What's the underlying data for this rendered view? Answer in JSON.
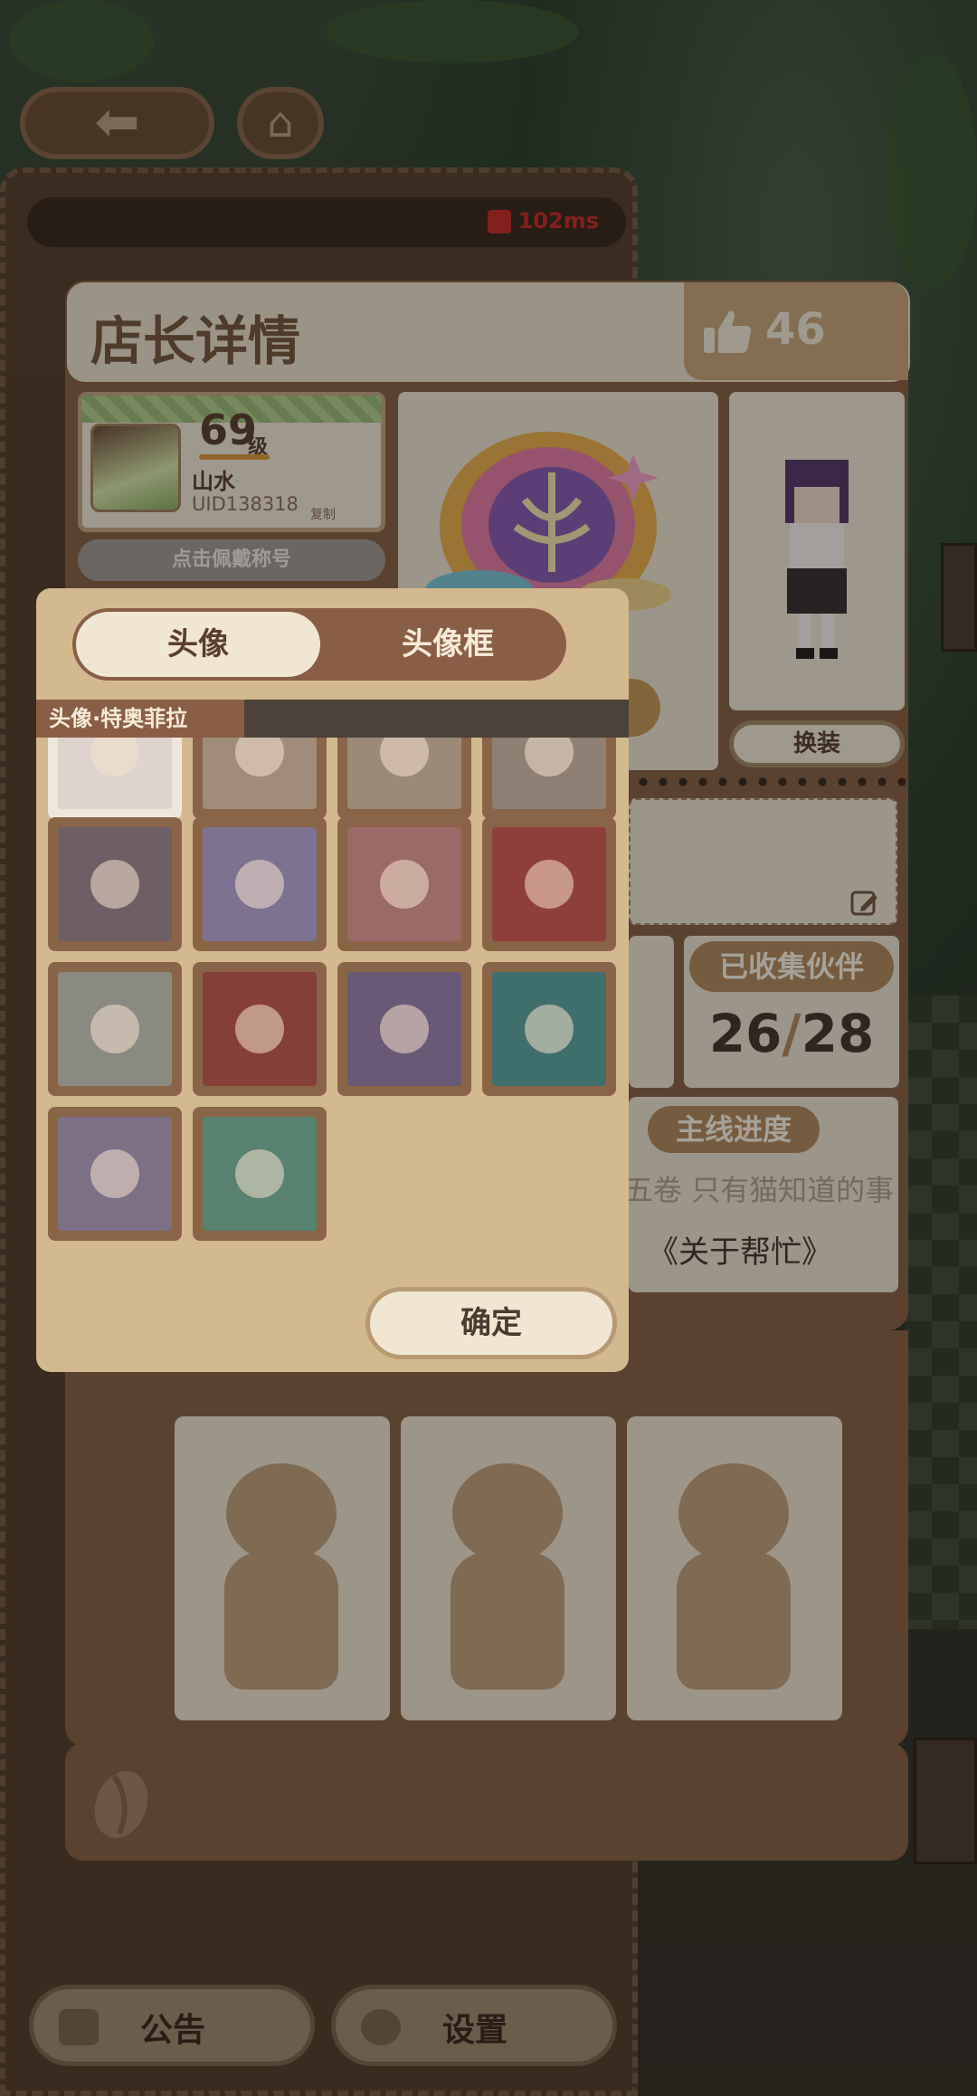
{
  "header": {
    "title": "店长详情",
    "likes": "46",
    "ping": "102ms"
  },
  "profile": {
    "level": "69",
    "level_unit": "级",
    "name": "山水",
    "uid": "UID138318",
    "copy_label": "复制",
    "wear_title_label": "点击佩戴称号"
  },
  "character": {
    "outfit_label": "换装"
  },
  "stats": {
    "partners_label": "已收集伙伴",
    "partners_collected": "26",
    "partners_total": "28",
    "story_label": "主线进度",
    "story_chapter": "五卷 只有猫知道的事",
    "story_quest": "《关于帮忙》"
  },
  "picker": {
    "tabs": [
      {
        "label": "头像",
        "active": true
      },
      {
        "label": "头像框",
        "active": false
      }
    ],
    "selected_label": "头像·特奥菲拉",
    "confirm_label": "确定",
    "avatars": [
      {
        "name": "avatar-option-1",
        "color": "#ded3cd"
      },
      {
        "name": "avatar-option-2",
        "color": "#a08c78"
      },
      {
        "name": "avatar-option-3",
        "color": "#9d8a76"
      },
      {
        "name": "avatar-option-4",
        "color": "#8f8073"
      },
      {
        "name": "avatar-option-5",
        "color": "#6e5e66"
      },
      {
        "name": "avatar-option-6",
        "color": "#7d7292"
      },
      {
        "name": "avatar-option-7",
        "color": "#9a6a66"
      },
      {
        "name": "avatar-option-8",
        "color": "#8e3f37"
      },
      {
        "name": "avatar-option-9",
        "color": "#8b8a80"
      },
      {
        "name": "avatar-option-10",
        "color": "#843f37"
      },
      {
        "name": "avatar-option-11",
        "color": "#6a5877"
      },
      {
        "name": "avatar-option-12",
        "color": "#3f6f6c"
      },
      {
        "name": "avatar-option-13",
        "color": "#7d6f86"
      },
      {
        "name": "avatar-option-14",
        "color": "#56826f"
      }
    ]
  },
  "bottom": {
    "notice_label": "公告",
    "settings_label": "设置"
  },
  "colors": {
    "accent": "#b38b5f",
    "panel": "#8a6446",
    "card": "#ede3d1",
    "ping": "#c9312b"
  },
  "icons": [
    "back-arrow-icon",
    "home-icon",
    "signal-icon",
    "thumbs-up-icon",
    "edit-icon",
    "coffee-bean-icon",
    "briefcase-icon",
    "gear-icon"
  ]
}
